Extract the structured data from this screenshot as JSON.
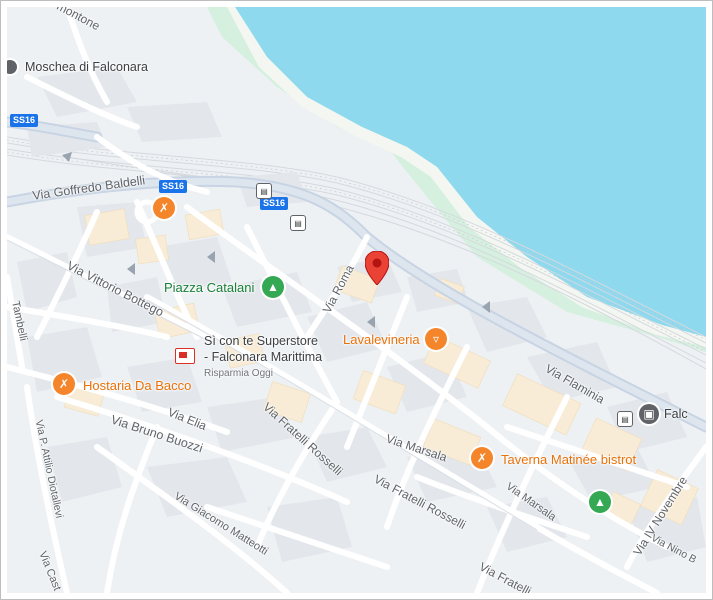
{
  "map": {
    "water_color": "#8ed9ee",
    "park_color": "#d6f0e0",
    "land_color": "#eef1f4",
    "road_color": "#ffffff",
    "major_road_color": "#c8d4e3",
    "pin_color": "#ea4335"
  },
  "streets": {
    "via_goffredo_baldelli": "Via Goffredo Baldelli",
    "via_vittorio_bottego": "Via Vittorio Bottego",
    "via_roma": "Via Roma",
    "via_elia": "Via Elia",
    "via_bruno_buozzi": "Via Bruno Buozzi",
    "via_fratelli_rosselli_1": "Via Fratelli Rosselli",
    "via_fratelli_rosselli_2": "Via Fratelli Rosselli",
    "via_fratelli_3": "Via Fratelli",
    "via_marsala_1": "Via Marsala",
    "via_marsala_2": "Via Marsala",
    "via_flaminia": "Via Flaminia",
    "via_giacomo_matteotti": "Via Giacomo Matteotti",
    "via_p_attilio_diotallevi": "Via P. Attilio Diotallevi",
    "via_iv_novembre": "Via IV Novembre",
    "via_nino": "Via Nino B",
    "via_cast": "Via Cast",
    "tambelli": "Tambelli",
    "montone": "montone"
  },
  "shields": {
    "ss16_a": "SS16",
    "ss16_b": "SS16",
    "ss16_c": "SS16"
  },
  "pois": {
    "moschea": "Moschea di Falconara",
    "piazza_catalani": "Piazza Catalani",
    "superstore_line1": "Sì con te Superstore",
    "superstore_line2": "- Falconara Marittima",
    "superstore_sub": "Risparmia Oggi",
    "lavalevineria": "Lavalevineria",
    "hostaria": "Hostaria Da Bacco",
    "taverna": "Taverna Matinée bistrot",
    "station": "Falc"
  },
  "icons": {
    "restaurant": "fork-knife-icon",
    "bar": "wine-glass-icon",
    "park": "tree-icon",
    "train": "train-icon",
    "bus": "bus-icon",
    "mosque": "mosque-icon",
    "pin": "location-pin-icon"
  }
}
